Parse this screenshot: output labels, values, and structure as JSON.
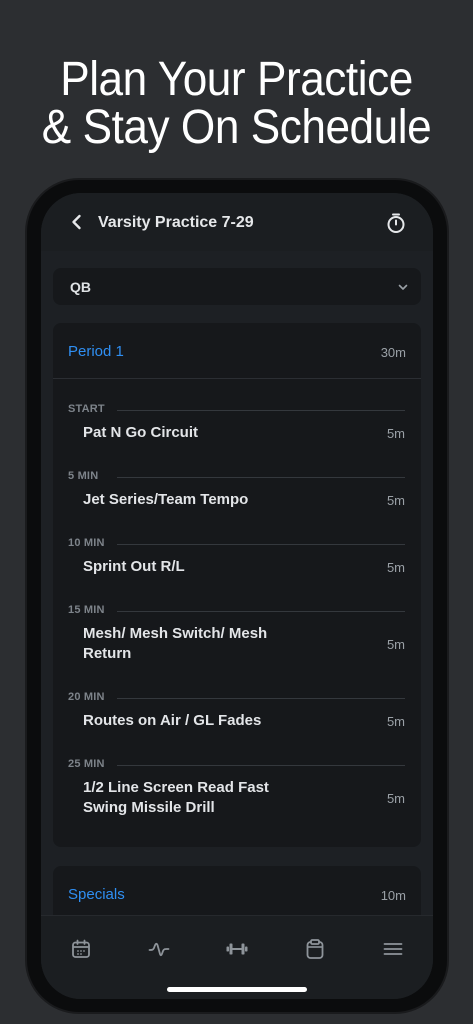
{
  "headline": {
    "line1": "Plan Your Practice",
    "line2": "& Stay On Schedule"
  },
  "nav": {
    "title": "Varsity Practice 7-29",
    "back_icon": "chevron-left-icon",
    "timer_icon": "stopwatch-icon"
  },
  "position_select": {
    "value": "QB"
  },
  "period1": {
    "title": "Period 1",
    "duration": "30m",
    "drills": [
      {
        "marker": "START",
        "name": "Pat N Go Circuit",
        "duration": "5m"
      },
      {
        "marker": "5 MIN",
        "name": "Jet Series/Team Tempo",
        "duration": "5m"
      },
      {
        "marker": "10 MIN",
        "name": "Sprint Out R/L",
        "duration": "5m"
      },
      {
        "marker": "15 MIN",
        "name": "Mesh/ Mesh Switch/ Mesh Return",
        "duration": "5m"
      },
      {
        "marker": "20 MIN",
        "name": "Routes on Air / GL Fades",
        "duration": "5m"
      },
      {
        "marker": "25 MIN",
        "name": "1/2 Line Screen Read Fast Swing Missile Drill",
        "duration": "5m"
      }
    ]
  },
  "specials": {
    "title": "Specials",
    "duration": "10m"
  },
  "tabbar": {
    "tabs": [
      {
        "icon": "calendar-icon"
      },
      {
        "icon": "activity-icon"
      },
      {
        "icon": "dumbbell-icon"
      },
      {
        "icon": "clipboard-icon"
      },
      {
        "icon": "menu-icon"
      }
    ]
  },
  "colors": {
    "accent": "#2f8ff3",
    "background": "#2c2e31",
    "card": "#16181b"
  }
}
